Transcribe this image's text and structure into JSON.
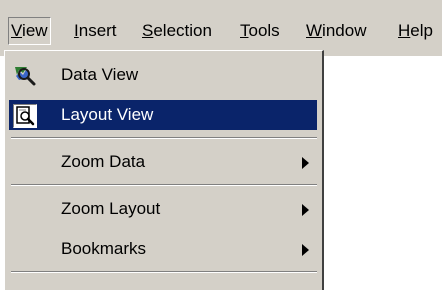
{
  "menubar": {
    "items": [
      {
        "label_mnemonic": "V",
        "label_rest": "iew"
      },
      {
        "label_mnemonic": "I",
        "label_rest": "nsert"
      },
      {
        "label_mnemonic": "S",
        "label_rest": "election"
      },
      {
        "label_mnemonic": "T",
        "label_rest": "ools"
      },
      {
        "label_mnemonic": "W",
        "label_rest": "indow"
      },
      {
        "label_mnemonic": "H",
        "label_rest": "elp"
      }
    ]
  },
  "view_menu": {
    "items": [
      {
        "label": "Data View",
        "icon": "data-view-icon"
      },
      {
        "label": "Layout View",
        "icon": "layout-view-icon",
        "highlighted": true
      },
      {
        "label": "Zoom Data",
        "submenu": true
      },
      {
        "label": "Zoom Layout",
        "submenu": true
      },
      {
        "label": "Bookmarks",
        "submenu": true
      }
    ]
  },
  "colors": {
    "menu_face": "#d4d0c8",
    "highlight": "#0a246a",
    "highlight_text": "#ffffff"
  }
}
